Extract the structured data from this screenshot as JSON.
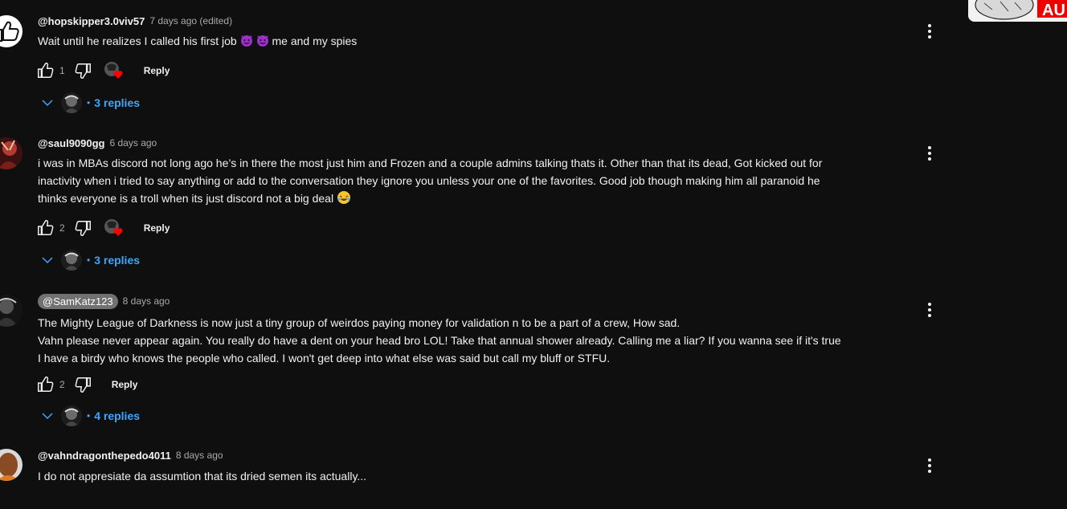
{
  "colors": {
    "background": "#0f0f0f",
    "text": "#f1f1f1",
    "muted": "#aaaaaa",
    "link": "#3ea6ff",
    "heart": "#ff0000"
  },
  "corner_thumbnail": {
    "badge_text": "AU"
  },
  "comments": [
    {
      "author": "@hopskipper3.0viv57",
      "time": "7 days ago (edited)",
      "lines": [
        "Wait until he realizes I called his first job",
        "me and my spies"
      ],
      "likes": "1",
      "hearted": true,
      "reply_label": "Reply",
      "replies_label": "3 replies",
      "avatar_icon": "thumbs-up-icon"
    },
    {
      "author": "@saul9090gg",
      "time": "6 days ago",
      "lines": [
        "i was in MBAs discord not long ago he’s in there the most just him and Frozen and a couple admins talking thats it. Other than that its dead, Got kicked out for",
        "inactivity when i tried to say anything or add to the conversation they ignore you unless your one of the favorites. Good job though making him all paranoid he",
        "thinks everyone is a troll when its just discord not a big deal"
      ],
      "likes": "2",
      "hearted": true,
      "reply_label": "Reply",
      "replies_label": "3 replies",
      "avatar_icon": "user-avatar"
    },
    {
      "author": "@SamKatz123",
      "time": "8 days ago",
      "lines": [
        "The Mighty League of Darkness is now just a tiny group of weirdos paying money for validation n to be a part of a crew, How sad.",
        "Vahn please never appear again. You really do have a dent on your head bro LOL! Take that annual shower already. Calling me a liar? If you wanna see if it's true",
        "I have a birdy who knows the people who called. I won't get deep into what else was said but call my bluff or STFU."
      ],
      "likes": "2",
      "hearted": false,
      "reply_label": "Reply",
      "replies_label": "4 replies",
      "avatar_icon": "user-avatar"
    },
    {
      "author": "@vahndragonthepedo4011",
      "time": "8 days ago",
      "lines": [
        "I do not appresiate da assumtion that its dried semen its actually..."
      ],
      "likes": "",
      "hearted": false,
      "reply_label": "",
      "replies_label": "",
      "avatar_icon": "user-avatar"
    }
  ]
}
